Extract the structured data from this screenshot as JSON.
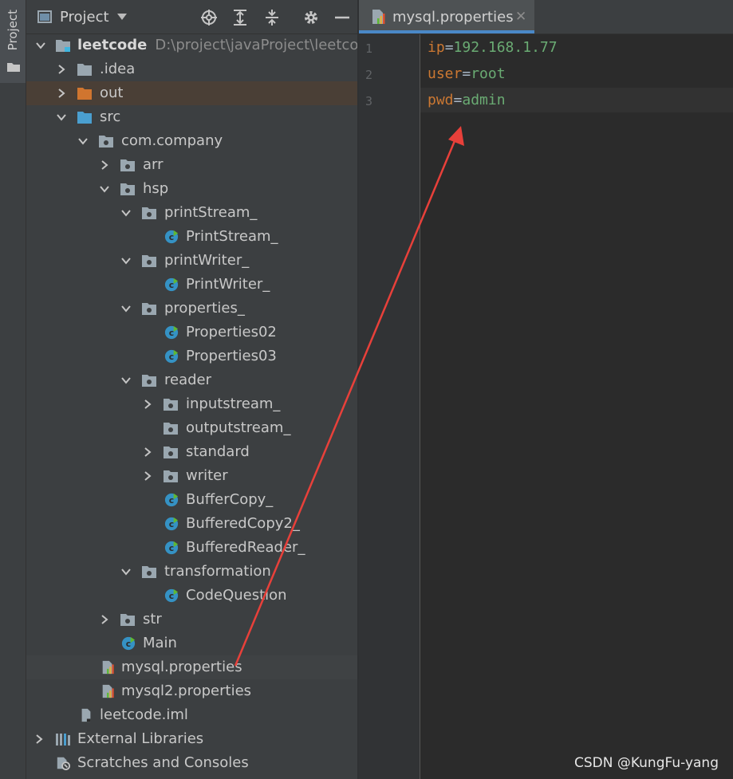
{
  "sidebar": {
    "project_tab": "Project"
  },
  "panel": {
    "title": "Project"
  },
  "tree": {
    "root": {
      "name": "leetcode",
      "path": "D:\\project\\javaProject\\leetcode"
    },
    "idea": ".idea",
    "out": "out",
    "src": "src",
    "company": "com.company",
    "arr": "arr",
    "hsp": "hsp",
    "printStream_dir": "printStream_",
    "printStream_cls": "PrintStream_",
    "printWriter_dir": "printWriter_",
    "printWriter_cls": "PrintWriter_",
    "properties_dir": "properties_",
    "properties02": "Properties02",
    "properties03": "Properties03",
    "reader": "reader",
    "inputstream": "inputstream_",
    "outputstream": "outputstream_",
    "standard": "standard",
    "writer": "writer",
    "buffercopy": "BufferCopy_",
    "bufferedcopy2": "BufferedCopy2_",
    "bufferedreader": "BufferedReader_",
    "transformation": "transformation",
    "codequestion": "CodeQuestion",
    "str": "str",
    "main": "Main",
    "mysql": "mysql.properties",
    "mysql2": "mysql2.properties",
    "iml": "leetcode.iml",
    "external": "External Libraries",
    "scratches": "Scratches and Consoles"
  },
  "editor": {
    "tab": "mysql.properties",
    "lines": [
      {
        "num": "1",
        "key": "ip",
        "value": "192.168.1.77"
      },
      {
        "num": "2",
        "key": "user",
        "value": "root"
      },
      {
        "num": "3",
        "key": "pwd",
        "value": "admin"
      }
    ]
  },
  "watermark": "CSDN @KungFu-yang",
  "colors": {
    "accent": "#4a88c7",
    "arrow": "#e8403a",
    "key": "#cc7832",
    "value": "#6a8759"
  }
}
